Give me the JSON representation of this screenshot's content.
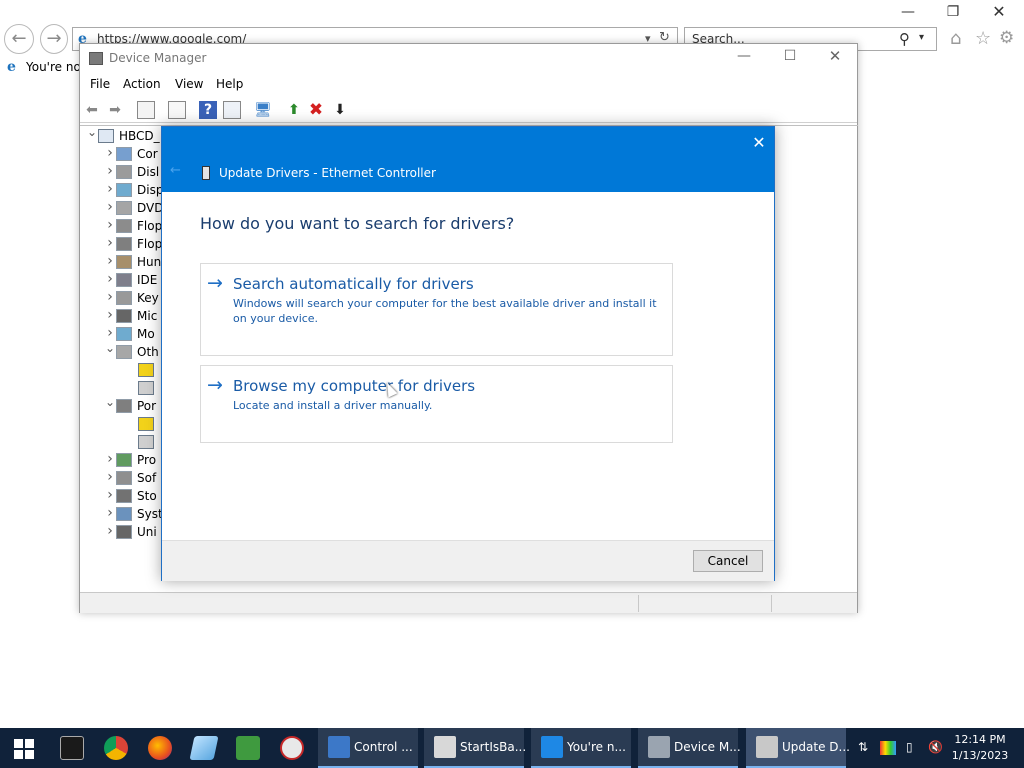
{
  "browser": {
    "url": "https://www.google.com/",
    "search_placeholder": "Search...",
    "tab_title": "You're not",
    "nav": {
      "back_glyph": "←",
      "forward_glyph": "→"
    },
    "icons": [
      "back-icon",
      "forward-icon",
      "ie-logo-icon",
      "refresh-icon",
      "search-icon",
      "home-icon",
      "favorites-star-icon",
      "settings-gear-icon"
    ]
  },
  "device_manager": {
    "title": "Device Manager",
    "menu": [
      "File",
      "Action",
      "View",
      "Help"
    ],
    "tree": [
      {
        "label": "HBCD_",
        "expanded": true,
        "level": 0
      },
      {
        "label": "Cor",
        "level": 1
      },
      {
        "label": "Disl",
        "level": 1
      },
      {
        "label": "Disp",
        "level": 1
      },
      {
        "label": "DVD",
        "level": 1
      },
      {
        "label": "Flop",
        "level": 1
      },
      {
        "label": "Flop",
        "level": 1
      },
      {
        "label": "Hun",
        "level": 1
      },
      {
        "label": "IDE",
        "level": 1
      },
      {
        "label": "Key",
        "level": 1
      },
      {
        "label": "Mic",
        "level": 1
      },
      {
        "label": "Mo",
        "level": 1
      },
      {
        "label": "Oth",
        "expanded": true,
        "level": 1
      },
      {
        "label": "Por",
        "expanded": true,
        "level": 1
      },
      {
        "label": "Pro",
        "level": 1
      },
      {
        "label": "Sof",
        "level": 1
      },
      {
        "label": "Sto",
        "level": 1
      },
      {
        "label": "Syst",
        "level": 1
      },
      {
        "label": "Uni",
        "level": 1
      }
    ]
  },
  "dialog": {
    "title": "Update Drivers - Ethernet Controller",
    "question": "How do you want to search for drivers?",
    "options": [
      {
        "title": "Search automatically for drivers",
        "desc": "Windows will search your computer for the best available driver and install it on your device."
      },
      {
        "title": "Browse my computer for drivers",
        "desc": "Locate and install a driver manually."
      }
    ],
    "cancel_label": "Cancel",
    "colors": {
      "header": "#0078d7",
      "link": "#1a5ba6"
    }
  },
  "taskbar": {
    "tasks": [
      {
        "label": "Control ...",
        "icon": "control-panel-icon"
      },
      {
        "label": "StartIsBa...",
        "icon": "document-icon"
      },
      {
        "label": "You're n...",
        "icon": "internet-explorer-icon"
      },
      {
        "label": "Device M...",
        "icon": "device-manager-icon"
      },
      {
        "label": "Update D...",
        "icon": "device-icon",
        "active": true
      }
    ],
    "time": "12:14 PM",
    "date": "1/13/2023"
  }
}
